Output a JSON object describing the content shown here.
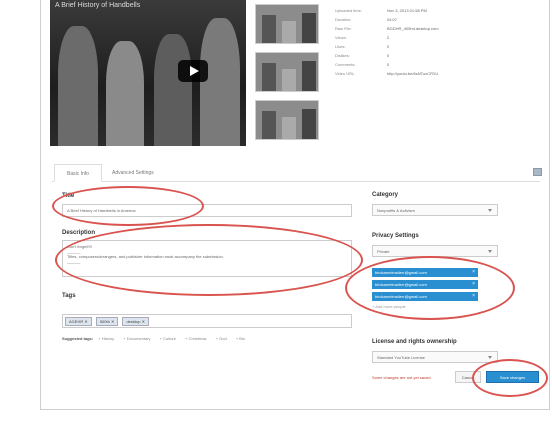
{
  "video": {
    "title": "A Brief History of Handbells",
    "play_icon": "play-icon"
  },
  "metadata": {
    "rows": [
      {
        "key": "Uploaded time:",
        "value": "Nov 3, 2013 01:58 PM"
      },
      {
        "key": "Duration:",
        "value": "04:07"
      },
      {
        "key": "Raw File:",
        "value": "BGDHR_405hd.desktop.com"
      },
      {
        "key": "Views:",
        "value": "2"
      },
      {
        "key": "Likes:",
        "value": "0"
      },
      {
        "key": "Dislikes:",
        "value": "0"
      },
      {
        "key": "Comments:",
        "value": "0"
      },
      {
        "key": "Video URL:",
        "value": "http://youtu.be/6sNTuxCFDU"
      }
    ]
  },
  "tabs": {
    "basic_info": "Basic Info",
    "advanced": "Advanced Settings"
  },
  "form": {
    "title_label": "Title",
    "title_value": "A Brief History of Handbells in America",
    "description_label": "Description",
    "description_lines": [
      "Don't forget!!!!",
      "______",
      "Titles, composers/arrangers, and publisher information must accompany the submission.",
      "______"
    ],
    "tags_label": "Tags",
    "tags": [
      "AGEHR",
      "500th",
      "desktop"
    ],
    "suggested_label": "Suggested tags:",
    "suggested_tags": [
      "+ History",
      "+ Documentary",
      "+ Culture",
      "+ Christmas",
      "+ God",
      "+ Bio"
    ],
    "category_label": "Category",
    "category_value": "Nonprofits & Activism",
    "privacy_label": "Privacy Settings",
    "privacy_value": "Private",
    "shared_emails": [
      "birdcamelmailerr@gmail.com",
      "birdcamelmailerr@gmail.com",
      "birdcamelmailerr@gmail.com"
    ],
    "add_more": "+ Add more people",
    "license_label": "License and rights ownership",
    "license_value": "Standard YouTube License"
  },
  "footer": {
    "unsaved_text": "Some changes are not yet saved.",
    "cancel_label": "Cancel",
    "save_label": "Save changes"
  },
  "colors": {
    "accent": "#2a8fd0",
    "annotation": "#d9534f"
  }
}
